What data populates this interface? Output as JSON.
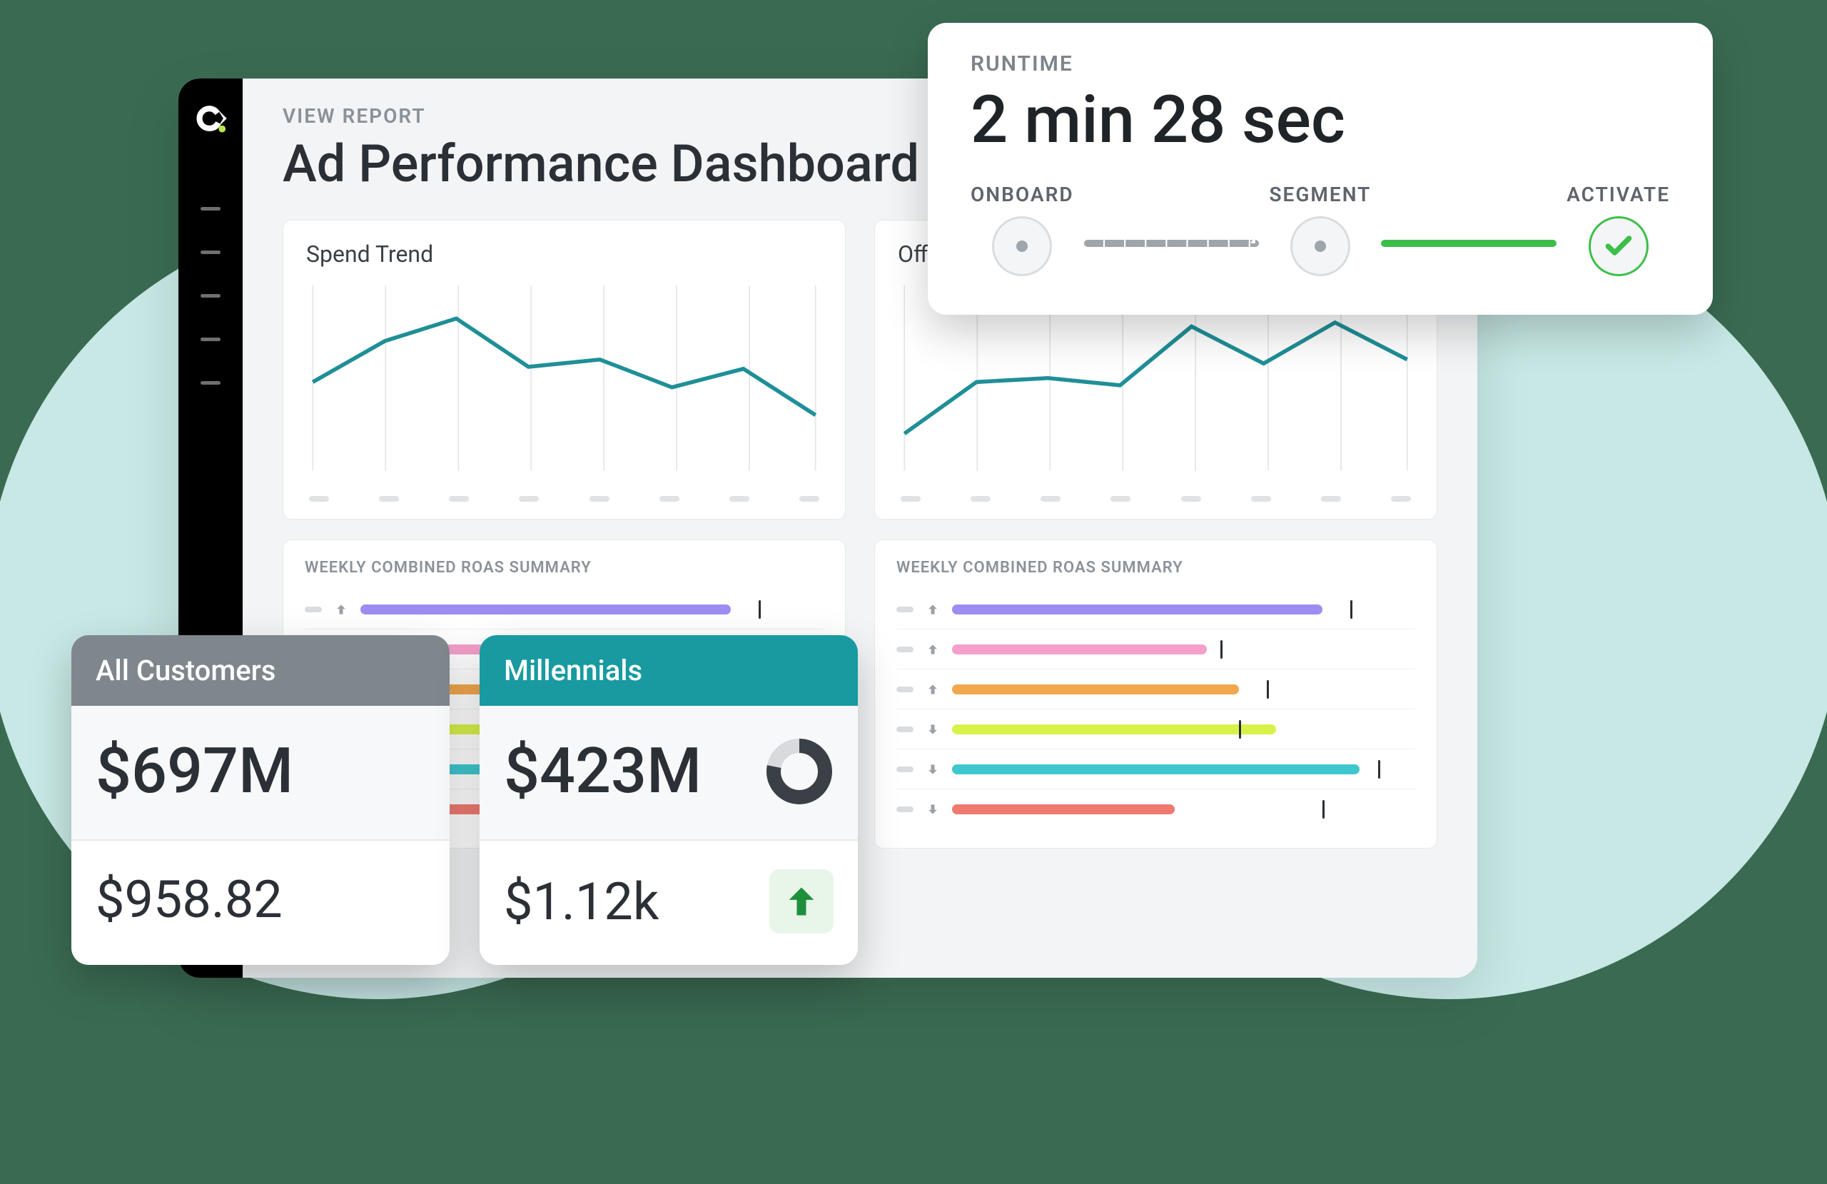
{
  "dashboard": {
    "eyebrow": "VIEW REPORT",
    "title": "Ad Performance Dashboard",
    "charts": {
      "spend_title": "Spend Trend",
      "offline_title": "Offline"
    },
    "table_caption": "WEEKLY COMBINED ROAS SUMMARY",
    "roas_rows": [
      {
        "dir": "up",
        "color": "#9d8cf2",
        "fill": 0.8,
        "marker": 0.86
      },
      {
        "dir": "up",
        "color": "#f59fcb",
        "fill": 0.55,
        "marker": 0.58
      },
      {
        "dir": "up",
        "color": "#f3a74c",
        "fill": 0.62,
        "marker": 0.68
      },
      {
        "dir": "down",
        "color": "#d9f24a",
        "fill": 0.7,
        "marker": 0.62
      },
      {
        "dir": "down",
        "color": "#3fc7cf",
        "fill": 0.88,
        "marker": 0.92
      },
      {
        "dir": "down",
        "color": "#f07a70",
        "fill": 0.48,
        "marker": 0.8
      }
    ]
  },
  "chart_data": [
    {
      "type": "line",
      "title": "Spend Trend",
      "x": [
        1,
        2,
        3,
        4,
        5,
        6,
        7,
        8
      ],
      "values": [
        48,
        70,
        82,
        56,
        60,
        45,
        55,
        30
      ],
      "ylim": [
        0,
        100
      ]
    },
    {
      "type": "line",
      "title": "Offline",
      "x": [
        1,
        2,
        3,
        4,
        5,
        6,
        7,
        8
      ],
      "values": [
        20,
        48,
        50,
        46,
        78,
        58,
        80,
        60
      ],
      "ylim": [
        0,
        100
      ]
    }
  ],
  "stat_cards": {
    "all_customers": {
      "label": "All Customers",
      "big": "$697M",
      "small": "$958.82"
    },
    "millennials": {
      "label": "Millennials",
      "big": "$423M",
      "small": "$1.12k",
      "trend": "up",
      "donut_pct": 0.78
    }
  },
  "runtime": {
    "eyebrow": "RUNTIME",
    "value": "2 min 28 sec",
    "steps": {
      "onboard": "ONBOARD",
      "segment": "SEGMENT",
      "activate": "ACTIVATE"
    }
  },
  "colors": {
    "teal": "#189aa0",
    "line": "#1f8f97",
    "green": "#3bbf4a",
    "trend_green": "#1f8f3c"
  }
}
